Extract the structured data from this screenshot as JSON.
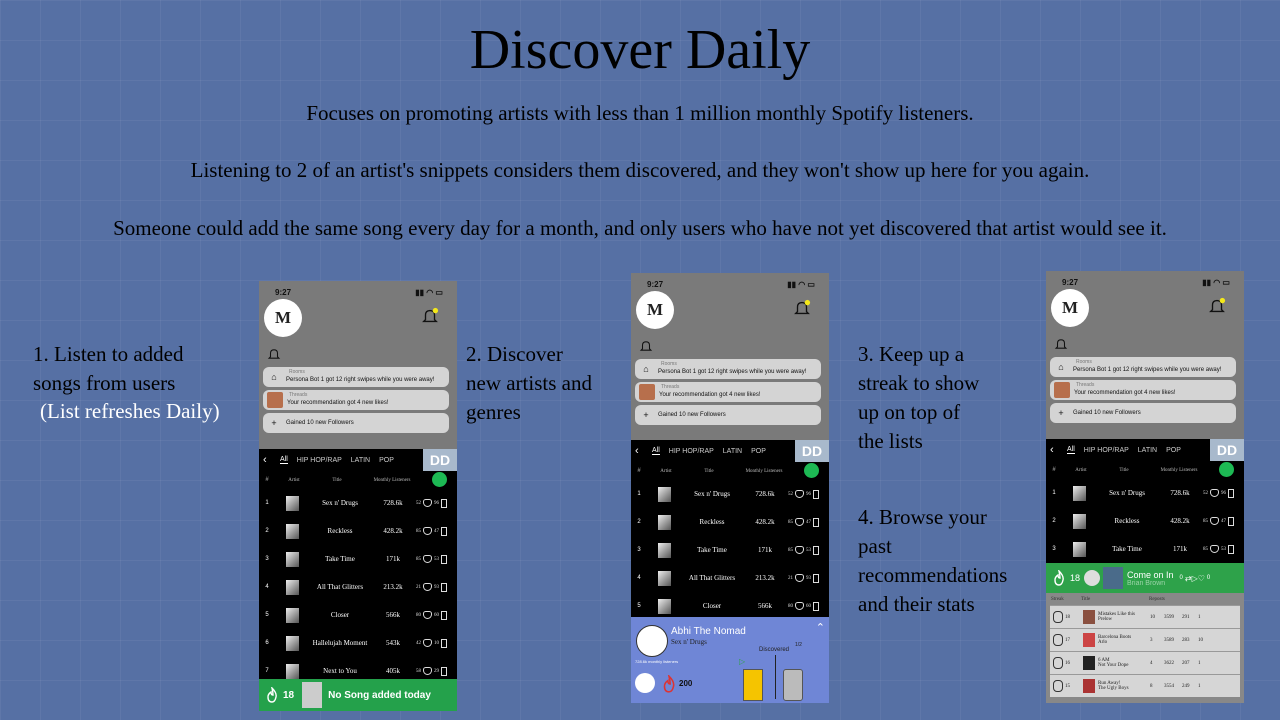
{
  "slide": {
    "title": "Discover Daily",
    "line1": "Focuses on promoting artists with less than 1 million monthly Spotify listeners.",
    "line2": "Listening to 2 of an artist's snippets considers them discovered, and they won't show up here for you again.",
    "line3": "Someone could add the same song every day for a month, and only users who have not yet discovered that artist would see it.",
    "step1": "1. Listen to added\nsongs from users",
    "step1b": "(List refreshes Daily)",
    "step2": "2. Discover\nnew artists and\ngenres",
    "step3": "3. Keep up a\nstreak to show\nup on top of\nthe lists",
    "step4": "4. Browse your\npast\nrecommendations\nand their stats"
  },
  "phone": {
    "time": "9:27",
    "logo": "M",
    "rooms_label": "Rooms",
    "rooms_text": "Persona Bot 1 got 12 right swipes while you were away!",
    "threads_label": "Threads",
    "threads_text": "Your recommendation got 4 new likes!",
    "followers_text": "Gained 10 new Followers",
    "tabs": [
      "All",
      "HIP HOP/RAP",
      "LATIN",
      "POP"
    ],
    "dd": "DD",
    "headers": {
      "num": "#",
      "artist": "Artist",
      "title": "Title",
      "listeners": "Monthly Listeners"
    },
    "songs": [
      {
        "n": "1",
        "title": "Sex n' Drugs",
        "listeners": "728.6k",
        "likes": "52",
        "hearts": "96"
      },
      {
        "n": "2",
        "title": "Reckless",
        "listeners": "428.2k",
        "likes": "85",
        "hearts": "47"
      },
      {
        "n": "3",
        "title": "Take Time",
        "listeners": "171k",
        "likes": "85",
        "hearts": "53"
      },
      {
        "n": "4",
        "title": "All That Glitters",
        "listeners": "213.2k",
        "likes": "21",
        "hearts": "93"
      },
      {
        "n": "5",
        "title": "Closer",
        "listeners": "566k",
        "likes": "80",
        "hearts": "60"
      },
      {
        "n": "6",
        "title": "Hallelujah Moment",
        "listeners": "543k",
        "likes": "42",
        "hearts": "10"
      },
      {
        "n": "7",
        "title": "Next to You",
        "listeners": "405k",
        "likes": "58",
        "hearts": "29"
      }
    ],
    "footer_streak": "18",
    "footer_text": "No Song added today"
  },
  "player": {
    "artist": "Abhi The Nomad",
    "song": "Sex n' Drugs",
    "listeners": "728.6k monthly listeners",
    "discovered": "Discovered",
    "progress": "1/2",
    "count": "200"
  },
  "phone3": {
    "strip_streak": "18",
    "strip_song": "Come on In",
    "strip_artist": "Brian Brown",
    "strip_stats": "0",
    "recent_headers": {
      "streak": "Streak",
      "title": "Title",
      "reposts": "Reposts"
    },
    "recent": [
      {
        "streak": "18",
        "title": "Mistakes Like this",
        "artist": "Prelow",
        "a": "10",
        "b": "3599",
        "c": "291",
        "d": "1"
      },
      {
        "streak": "17",
        "title": "Barcelona Boots",
        "artist": "Arlo",
        "a": "3",
        "b": "3589",
        "c": "283",
        "d": "10"
      },
      {
        "streak": "16",
        "title": "6 AM",
        "artist": "Not Your Dope",
        "a": "4",
        "b": "3622",
        "c": "207",
        "d": "1"
      },
      {
        "streak": "15",
        "title": "Run Away!",
        "artist": "The Ugly Boys",
        "a": "8",
        "b": "3554",
        "c": "249",
        "d": "1"
      }
    ]
  }
}
